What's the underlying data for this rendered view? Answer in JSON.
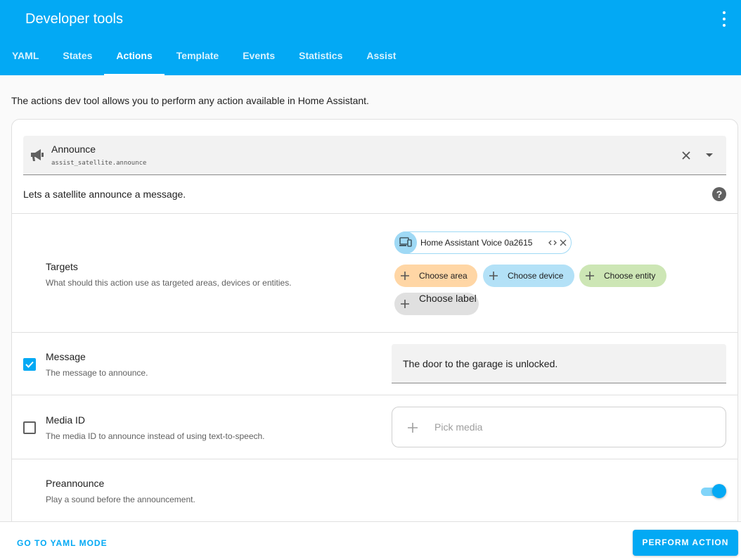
{
  "header": {
    "title": "Developer tools",
    "menu_icon": "more-vertical-icon",
    "accent_color": "#03a9f4"
  },
  "tabs": [
    {
      "label": "YAML",
      "active": false
    },
    {
      "label": "States",
      "active": false
    },
    {
      "label": "Actions",
      "active": true
    },
    {
      "label": "Template",
      "active": false
    },
    {
      "label": "Events",
      "active": false
    },
    {
      "label": "Statistics",
      "active": false
    },
    {
      "label": "Assist",
      "active": false
    }
  ],
  "intro": "The actions dev tool allows you to perform any action available in Home Assistant.",
  "action": {
    "icon": "megaphone-icon",
    "name": "Announce",
    "id": "assist_satellite.announce",
    "description": "Lets a satellite announce a message.",
    "help_icon": "question-icon",
    "help_glyph": "?"
  },
  "targets": {
    "label": "Targets",
    "hint": "What should this action use as targeted areas, devices or entities.",
    "selected": {
      "icon": "device-icon",
      "label": "Home Assistant Voice 0a2615"
    },
    "chips": {
      "area": "Choose area",
      "device": "Choose device",
      "entity": "Choose entity",
      "label": "Choose label"
    },
    "chip_colors": {
      "area": "#ffd6a5",
      "device": "#b3e1f7",
      "entity": "#cde6b5",
      "label": "#e0e0e0"
    }
  },
  "message": {
    "checked": true,
    "label": "Message",
    "hint": "The message to announce.",
    "value": "The door to the garage is unlocked."
  },
  "media": {
    "checked": false,
    "label": "Media ID",
    "hint": "The media ID to announce instead of using text-to-speech.",
    "placeholder": "Pick media"
  },
  "preannounce": {
    "label": "Preannounce",
    "hint": "Play a sound before the announcement.",
    "enabled": true
  },
  "footer": {
    "yaml_mode": "GO TO YAML MODE",
    "perform": "PERFORM ACTION"
  }
}
